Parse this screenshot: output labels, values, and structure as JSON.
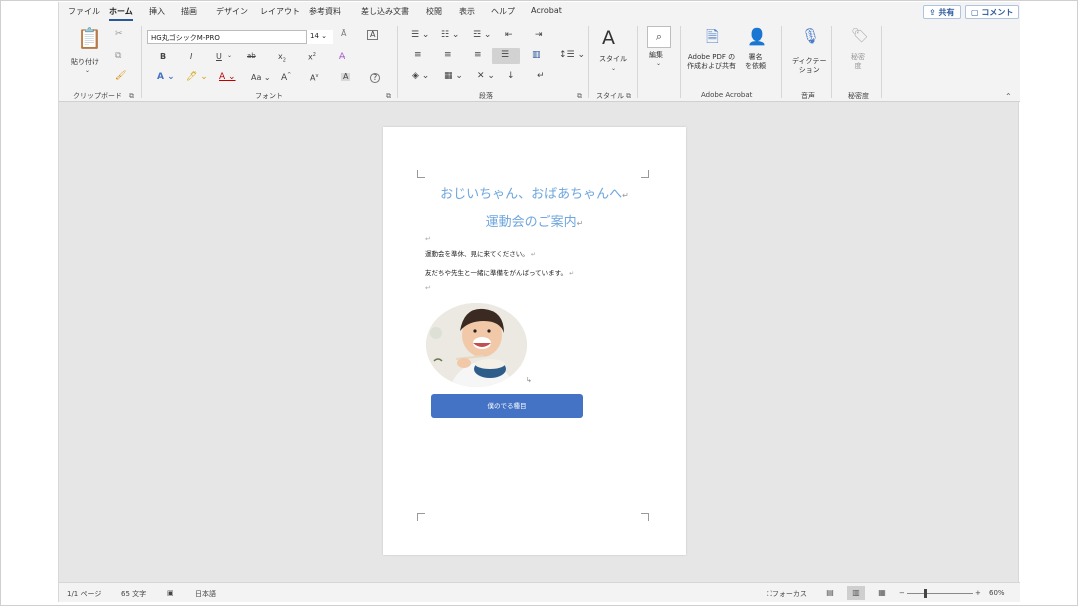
{
  "tabs": [
    "ファイル",
    "ホーム",
    "挿入",
    "描画",
    "デザイン",
    "レイアウト",
    "参考資料",
    "差し込み文書",
    "校閲",
    "表示",
    "ヘルプ",
    "Acrobat"
  ],
  "header": {
    "share": "共有",
    "comment": "コメント",
    "share_icon": "share-icon",
    "comment_icon": "comment-icon"
  },
  "ribbon": {
    "clipboard": {
      "paste": "貼り付け",
      "group": "クリップボード"
    },
    "font": {
      "name": "HG丸ゴシックM-PRO",
      "size": "14",
      "group": "フォント",
      "case_label": "Aa",
      "grow": "A",
      "shrink": "A",
      "bold": "B",
      "italic": "I",
      "underline": "U",
      "strike": "ab",
      "sub": "x",
      "sup": "x"
    },
    "paragraph": {
      "group": "段落"
    },
    "styles": {
      "label": "スタイル",
      "group": "スタイル"
    },
    "editing": {
      "label": "編集"
    },
    "acrobat": {
      "create": "Adobe PDF の\n作成および共有",
      "sign": "署名\nを依頼",
      "group": "Adobe Acrobat"
    },
    "voice": {
      "dictate": "ディクテー\nション",
      "group": "音声"
    },
    "sensitivity": {
      "label": "秘密\n度",
      "group": "秘密度"
    }
  },
  "document": {
    "title_line1": "おじいちゃん、おばあちゃんへ",
    "title_line2": "運動会のご案内",
    "para_mark": "↵",
    "line1": "運動会を準休、見に来てください。",
    "line2": "友だちや先生と一緒に準備をがんばっています。",
    "button": "僕のでる種目"
  },
  "status": {
    "page": "1/1 ページ",
    "words": "65 文字",
    "language": "日本語",
    "focus": "フォーカス",
    "zoom": "60%",
    "zoom_minus": "−",
    "zoom_plus": "+"
  },
  "colors": {
    "accent": "#2b579a",
    "title": "#6ea6dd",
    "button": "#4472c4"
  }
}
